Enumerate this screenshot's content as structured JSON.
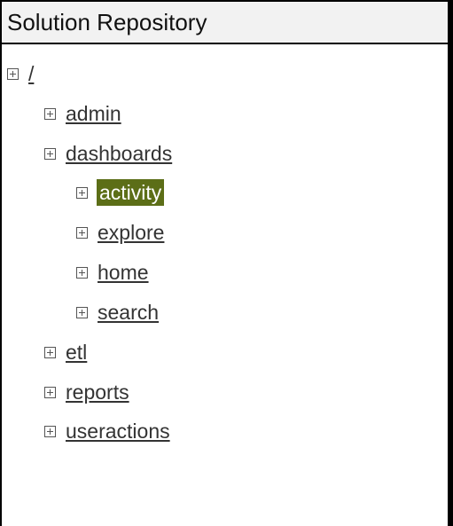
{
  "header": {
    "title": "Solution Repository"
  },
  "tree": {
    "root": {
      "label": "/",
      "expander_icon": "plus-box-icon"
    },
    "nodes": [
      {
        "label": "admin"
      },
      {
        "label": "dashboards"
      },
      {
        "label": "activity",
        "selected": true
      },
      {
        "label": "explore"
      },
      {
        "label": "home"
      },
      {
        "label": "search"
      },
      {
        "label": "etl"
      },
      {
        "label": "reports"
      },
      {
        "label": "useractions"
      }
    ]
  },
  "colors": {
    "selected_background": "#5c6e17",
    "selected_text": "#ffffff",
    "link_text": "#333333"
  }
}
